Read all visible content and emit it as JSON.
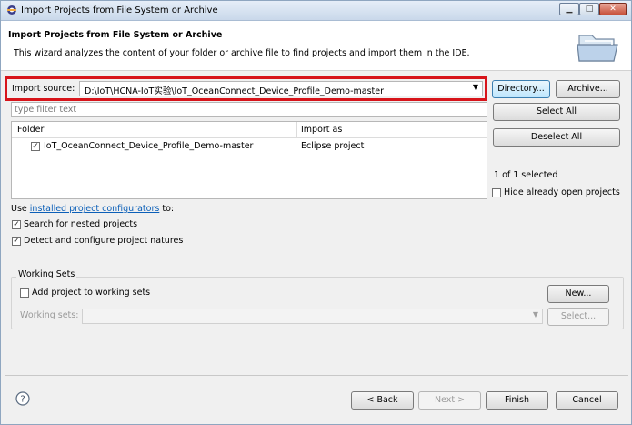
{
  "window": {
    "title": "Import Projects from File System or Archive",
    "controls": {
      "minimize": "▁",
      "maximize": "□",
      "close": "✕"
    }
  },
  "banner": {
    "title": "Import Projects from File System or Archive",
    "description": "This wizard analyzes the content of your folder or archive file to find projects and import them in the IDE."
  },
  "source": {
    "label": "Import source:",
    "value": "D:\\IoT\\HCNA-IoT实验\\IoT_OceanConnect_Device_Profile_Demo-master",
    "directory_button": "Directory...",
    "archive_button": "Archive..."
  },
  "filter": {
    "placeholder": "type filter text",
    "value": ""
  },
  "table": {
    "columns": [
      "Folder",
      "Import as"
    ],
    "rows": [
      {
        "checked": true,
        "folder": "IoT_OceanConnect_Device_Profile_Demo-master",
        "import_as": "Eclipse project"
      }
    ]
  },
  "actions": {
    "select_all": "Select All",
    "deselect_all": "Deselect All",
    "selection_count": "1 of 1 selected",
    "hide_open_label": "Hide already open projects",
    "hide_open_checked": false
  },
  "options": {
    "use_prefix": "Use ",
    "use_link": "installed project configurators",
    "use_suffix": " to:",
    "nested_label": "Search for nested projects",
    "nested_checked": true,
    "detect_label": "Detect and configure project natures",
    "detect_checked": true
  },
  "working_sets": {
    "group_title": "Working Sets",
    "add_label": "Add project to working sets",
    "add_checked": false,
    "new_button": "New...",
    "sets_label": "Working sets:",
    "select_button": "Select..."
  },
  "footer": {
    "back": "< Back",
    "next": "Next >",
    "finish": "Finish",
    "cancel": "Cancel"
  },
  "colors": {
    "highlight_border": "#d7141a",
    "link": "#0b5fb8",
    "focus_button": "#bee6fd"
  },
  "icons": [
    "app-icon",
    "folder-open-icon",
    "help-icon",
    "dropdown-arrow-icon",
    "checkbox-icon"
  ]
}
